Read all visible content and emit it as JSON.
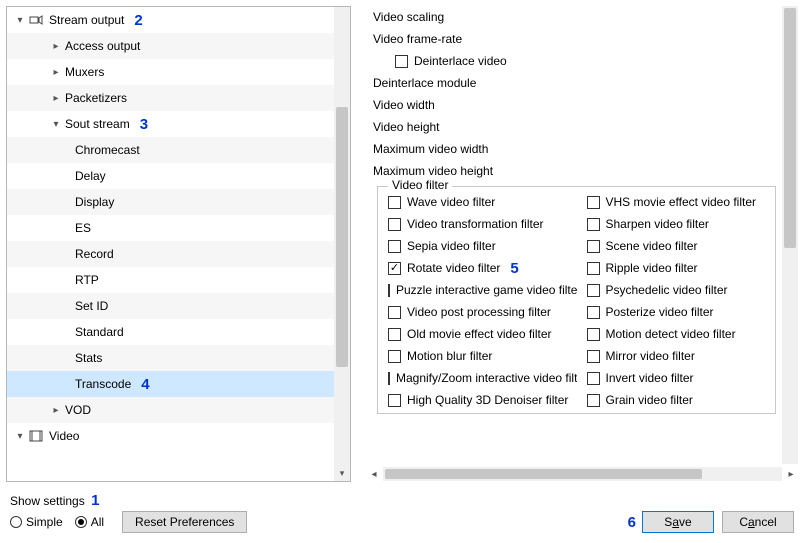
{
  "tree": {
    "stream_output": "Stream output",
    "access_output": "Access output",
    "muxers": "Muxers",
    "packetizers": "Packetizers",
    "sout_stream": "Sout stream",
    "chromecast": "Chromecast",
    "delay": "Delay",
    "display": "Display",
    "es": "ES",
    "record": "Record",
    "rtp": "RTP",
    "set_id": "Set ID",
    "standard": "Standard",
    "stats": "Stats",
    "transcode": "Transcode",
    "vod": "VOD",
    "video": "Video"
  },
  "right": {
    "video_scaling": "Video scaling",
    "video_framerate": "Video frame-rate",
    "deinterlace_video": "Deinterlace video",
    "deinterlace_module": "Deinterlace module",
    "video_width": "Video width",
    "video_height": "Video height",
    "max_video_width": "Maximum video width",
    "max_video_height": "Maximum video height",
    "video_filter_legend": "Video filter"
  },
  "filters_left": [
    {
      "label": "Wave video filter",
      "checked": false
    },
    {
      "label": "Video transformation filter",
      "checked": false
    },
    {
      "label": "Sepia video filter",
      "checked": false
    },
    {
      "label": "Rotate video filter",
      "checked": true
    },
    {
      "label": "Puzzle interactive game video filter",
      "checked": false
    },
    {
      "label": "Video post processing filter",
      "checked": false
    },
    {
      "label": "Old movie effect video filter",
      "checked": false
    },
    {
      "label": "Motion blur filter",
      "checked": false
    },
    {
      "label": "Magnify/Zoom interactive video filter",
      "checked": false
    },
    {
      "label": "High Quality 3D Denoiser filter",
      "checked": false
    }
  ],
  "filters_right": [
    {
      "label": "VHS movie effect video filter",
      "checked": false
    },
    {
      "label": "Sharpen video filter",
      "checked": false
    },
    {
      "label": "Scene video filter",
      "checked": false
    },
    {
      "label": "Ripple video filter",
      "checked": false
    },
    {
      "label": "Psychedelic video filter",
      "checked": false
    },
    {
      "label": "Posterize video filter",
      "checked": false
    },
    {
      "label": "Motion detect video filter",
      "checked": false
    },
    {
      "label": "Mirror video filter",
      "checked": false
    },
    {
      "label": "Invert video filter",
      "checked": false
    },
    {
      "label": "Grain video filter",
      "checked": false
    }
  ],
  "footer": {
    "show_settings": "Show settings",
    "simple": "Simple",
    "all": "All",
    "reset": "Reset Preferences",
    "save_prefix": "S",
    "save_ul": "a",
    "save_suffix": "ve",
    "cancel_prefix": "C",
    "cancel_ul": "a",
    "cancel_suffix": "ncel"
  },
  "markers": {
    "m1": "1",
    "m2": "2",
    "m3": "3",
    "m4": "4",
    "m5": "5",
    "m6": "6"
  }
}
